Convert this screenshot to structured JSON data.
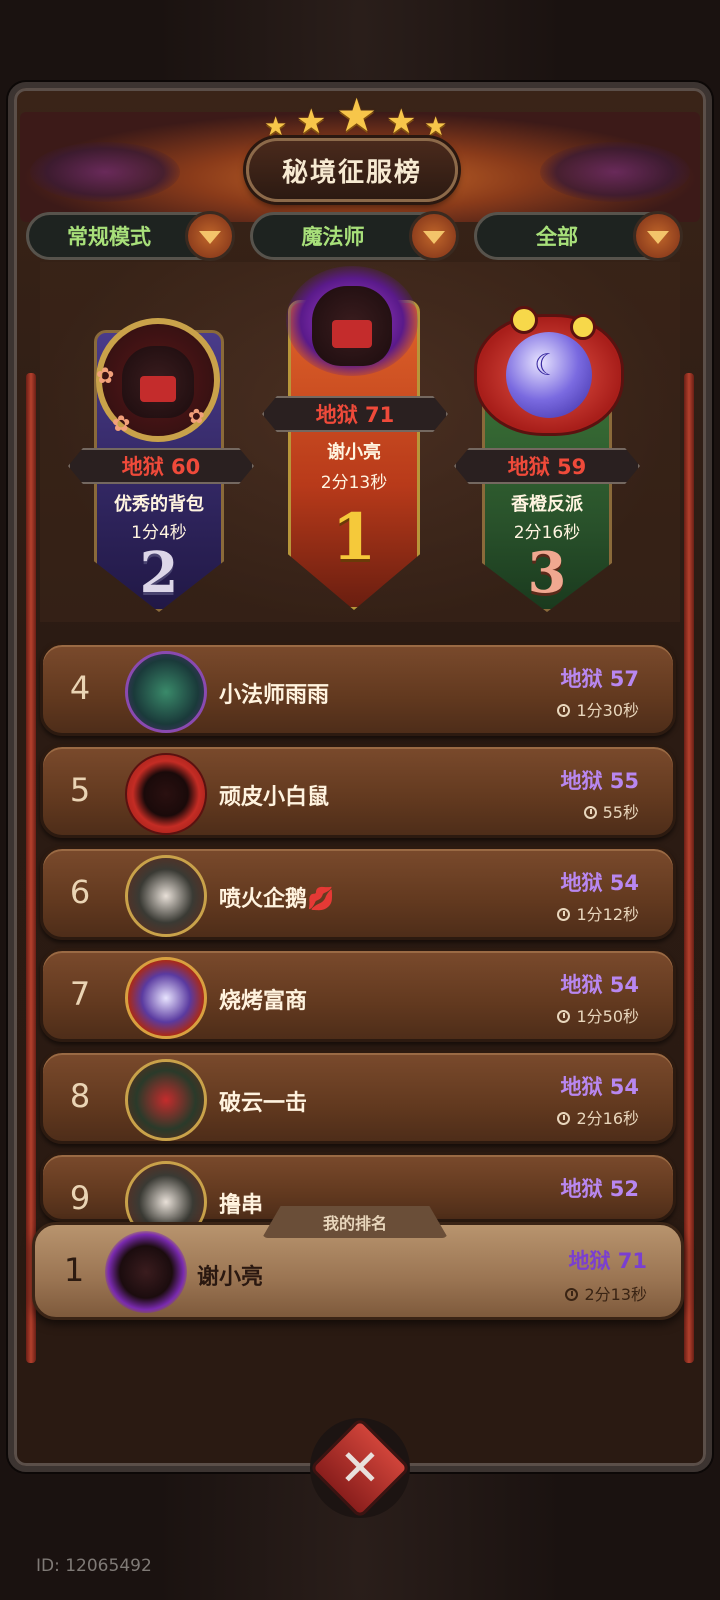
{
  "header": {
    "title": "秘境征服榜",
    "stars": 5
  },
  "filters": [
    {
      "label": "常规模式"
    },
    {
      "label": "魔法师"
    },
    {
      "label": "全部"
    }
  ],
  "podium": {
    "first": {
      "rank": "1",
      "score": "地狱 71",
      "name": "谢小亮",
      "time": "2分13秒"
    },
    "second": {
      "rank": "2",
      "score": "地狱 60",
      "name": "优秀的背包",
      "time": "1分4秒"
    },
    "third": {
      "rank": "3",
      "score": "地狱 59",
      "name": "香橙反派",
      "time": "2分16秒"
    }
  },
  "list": [
    {
      "rank": "4",
      "name": "小法师雨雨",
      "score": "地狱 57",
      "time": "1分30秒"
    },
    {
      "rank": "5",
      "name": "顽皮小白鼠",
      "score": "地狱 55",
      "time": "55秒"
    },
    {
      "rank": "6",
      "name": "喷火企鹅💋",
      "score": "地狱 54",
      "time": "1分12秒"
    },
    {
      "rank": "7",
      "name": "烧烤富商",
      "score": "地狱 54",
      "time": "1分50秒"
    },
    {
      "rank": "8",
      "name": "破云一击",
      "score": "地狱 54",
      "time": "2分16秒"
    },
    {
      "rank": "9",
      "name": "撸串",
      "score": "地狱 52",
      "time": ""
    }
  ],
  "my_rank": {
    "tag": "我的排名",
    "rank": "1",
    "name": "谢小亮",
    "score": "地狱 71",
    "time": "2分13秒"
  },
  "footer": {
    "id": "ID: 12065492"
  },
  "colors": {
    "score_purple": "#b887f0",
    "score_red": "#ef4a3a",
    "filter_green": "#a8e07a"
  }
}
